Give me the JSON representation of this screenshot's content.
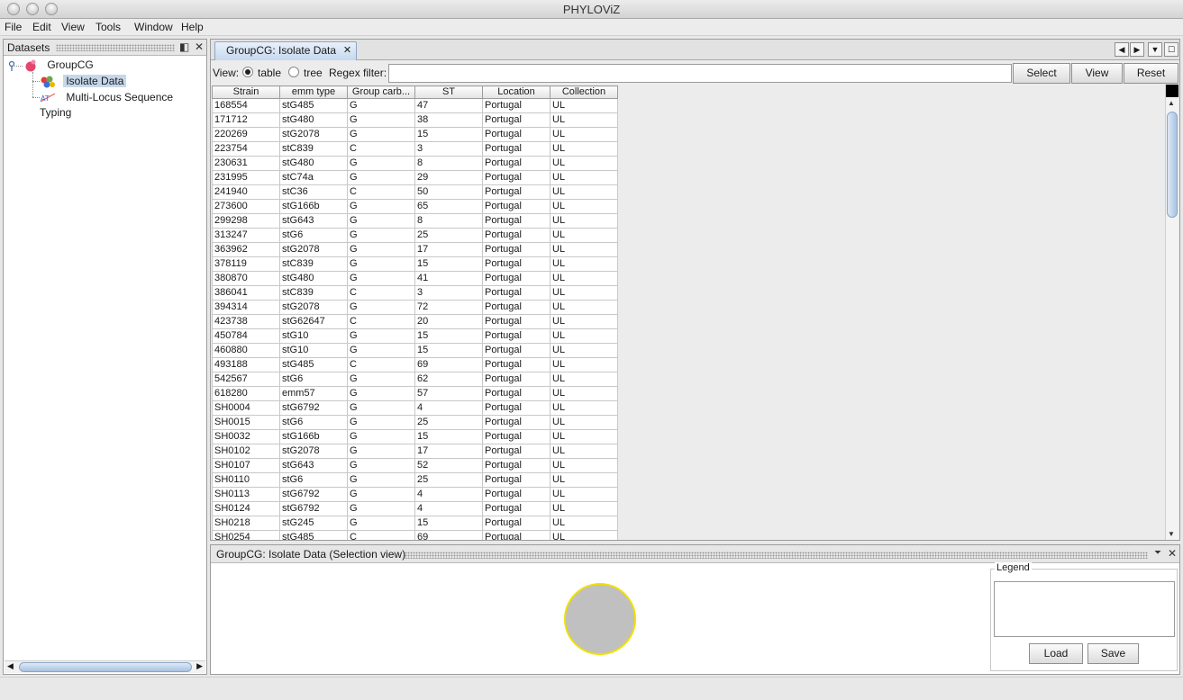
{
  "window": {
    "title": "PHYLOViZ"
  },
  "menu": [
    "File",
    "Edit",
    "View",
    "Tools",
    "Window",
    "Help"
  ],
  "datasets_pane": {
    "title": "Datasets",
    "tree": {
      "root": "GroupCG",
      "children": [
        "Isolate Data",
        "Multi-Locus Sequence Typing"
      ]
    }
  },
  "editor": {
    "tab_label": "GroupCG: Isolate Data",
    "view_label": "View:",
    "view_options": [
      "table",
      "tree"
    ],
    "view_selected": "table",
    "regex_label": "Regex filter:",
    "regex_value": "",
    "buttons": {
      "select": "Select",
      "view": "View",
      "reset": "Reset"
    }
  },
  "table": {
    "columns": [
      "Strain",
      "emm type",
      "Group carb...",
      "ST",
      "Location",
      "Collection"
    ],
    "rows": [
      [
        "168554",
        "stG485",
        "G",
        "47",
        "Portugal",
        "UL"
      ],
      [
        "171712",
        "stG480",
        "G",
        "38",
        "Portugal",
        "UL"
      ],
      [
        "220269",
        "stG2078",
        "G",
        "15",
        "Portugal",
        "UL"
      ],
      [
        "223754",
        "stC839",
        "C",
        "3",
        "Portugal",
        "UL"
      ],
      [
        "230631",
        "stG480",
        "G",
        "8",
        "Portugal",
        "UL"
      ],
      [
        "231995",
        "stC74a",
        "G",
        "29",
        "Portugal",
        "UL"
      ],
      [
        "241940",
        "stC36",
        "C",
        "50",
        "Portugal",
        "UL"
      ],
      [
        "273600",
        "stG166b",
        "G",
        "65",
        "Portugal",
        "UL"
      ],
      [
        "299298",
        "stG643",
        "G",
        "8",
        "Portugal",
        "UL"
      ],
      [
        "313247",
        "stG6",
        "G",
        "25",
        "Portugal",
        "UL"
      ],
      [
        "363962",
        "stG2078",
        "G",
        "17",
        "Portugal",
        "UL"
      ],
      [
        "378119",
        "stC839",
        "G",
        "15",
        "Portugal",
        "UL"
      ],
      [
        "380870",
        "stG480",
        "G",
        "41",
        "Portugal",
        "UL"
      ],
      [
        "386041",
        "stC839",
        "C",
        "3",
        "Portugal",
        "UL"
      ],
      [
        "394314",
        "stG2078",
        "G",
        "72",
        "Portugal",
        "UL"
      ],
      [
        "423738",
        "stG62647",
        "C",
        "20",
        "Portugal",
        "UL"
      ],
      [
        "450784",
        "stG10",
        "G",
        "15",
        "Portugal",
        "UL"
      ],
      [
        "460880",
        "stG10",
        "G",
        "15",
        "Portugal",
        "UL"
      ],
      [
        "493188",
        "stG485",
        "C",
        "69",
        "Portugal",
        "UL"
      ],
      [
        "542567",
        "stG6",
        "G",
        "62",
        "Portugal",
        "UL"
      ],
      [
        "618280",
        "emm57",
        "G",
        "57",
        "Portugal",
        "UL"
      ],
      [
        "SH0004",
        "stG6792",
        "G",
        "4",
        "Portugal",
        "UL"
      ],
      [
        "SH0015",
        "stG6",
        "G",
        "25",
        "Portugal",
        "UL"
      ],
      [
        "SH0032",
        "stG166b",
        "G",
        "15",
        "Portugal",
        "UL"
      ],
      [
        "SH0102",
        "stG2078",
        "G",
        "17",
        "Portugal",
        "UL"
      ],
      [
        "SH0107",
        "stG643",
        "G",
        "52",
        "Portugal",
        "UL"
      ],
      [
        "SH0110",
        "stG6",
        "G",
        "25",
        "Portugal",
        "UL"
      ],
      [
        "SH0113",
        "stG6792",
        "G",
        "4",
        "Portugal",
        "UL"
      ],
      [
        "SH0124",
        "stG6792",
        "G",
        "4",
        "Portugal",
        "UL"
      ],
      [
        "SH0218",
        "stG245",
        "G",
        "15",
        "Portugal",
        "UL"
      ],
      [
        "SH0254",
        "stG485",
        "C",
        "69",
        "Portugal",
        "UL"
      ]
    ]
  },
  "selection_view": {
    "title": "GroupCG: Isolate Data (Selection view)",
    "legend_title": "Legend",
    "buttons": {
      "load": "Load",
      "save": "Save"
    },
    "colors": {
      "circle_fill": "#c0c0c0",
      "circle_stroke": "#f1e000"
    }
  }
}
